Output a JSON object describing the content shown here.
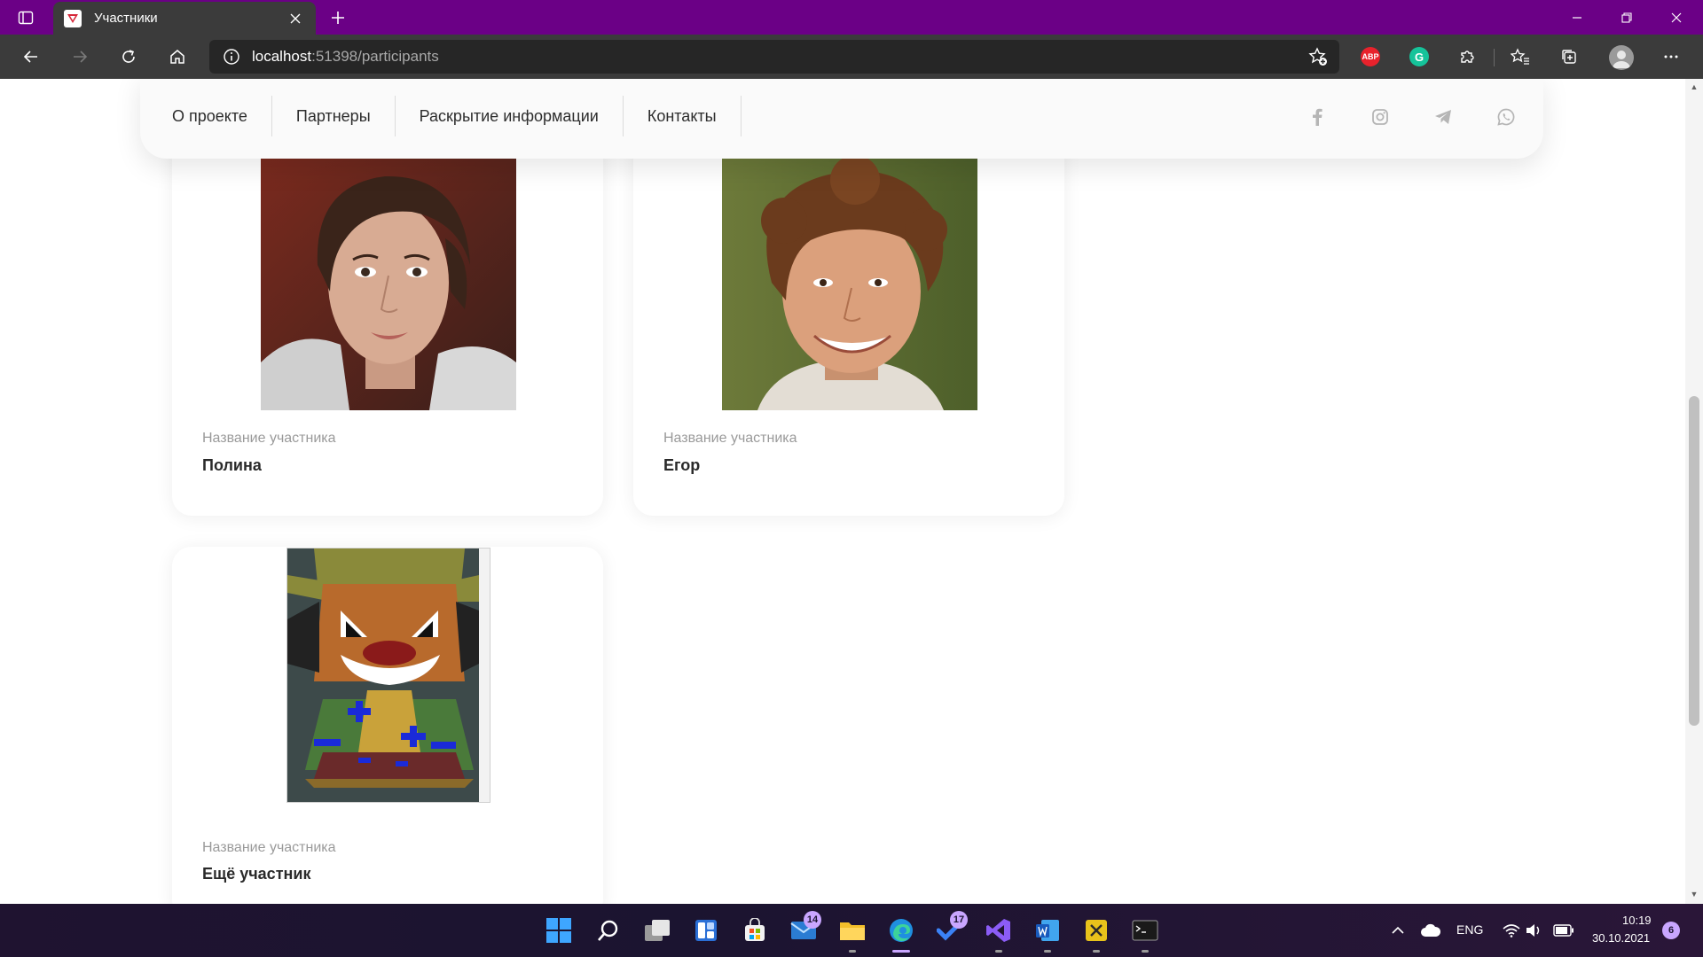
{
  "browser": {
    "tab": {
      "title": "Участники"
    },
    "address": {
      "host": "localhost",
      "rest": ":51398/participants"
    },
    "extensions": {
      "abp_label": "ABP",
      "grammarly_label": "G"
    }
  },
  "nav": {
    "items": [
      {
        "label": "О проекте"
      },
      {
        "label": "Партнеры"
      },
      {
        "label": "Раскрытие информации"
      },
      {
        "label": "Контакты"
      }
    ],
    "social_icons": [
      "facebook-icon",
      "instagram-icon",
      "telegram-icon",
      "whatsapp-icon"
    ]
  },
  "participants": [
    {
      "label": "Название участника",
      "name": "Полина"
    },
    {
      "label": "Название участника",
      "name": "Егор"
    },
    {
      "label": "Название участника",
      "name": "Ещё участник"
    }
  ],
  "taskbar": {
    "mail_badge": "14",
    "todo_badge": "17",
    "lang": "ENG",
    "time": "10:19",
    "date": "30.10.2021",
    "notifications": "6"
  },
  "colors": {
    "titlebar": "#6b0086",
    "toolbar": "#3b3b3b",
    "address_bg": "#262626",
    "abp": "#e8222c",
    "grammarly": "#15c39a"
  }
}
